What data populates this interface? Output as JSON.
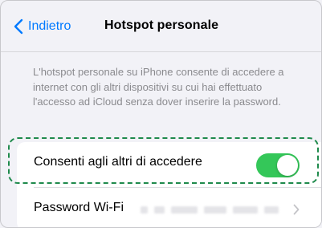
{
  "navbar": {
    "back_label": "Indietro",
    "title": "Hotspot personale"
  },
  "description": "L'hotspot personale su iPhone consente di accedere a internet con gli altri dispositivi su cui hai effettuato l'accesso ad iCloud senza dover inserire la password.",
  "settings": {
    "allow_others_label": "Consenti agli altri di accedere",
    "allow_others_enabled": true,
    "wifi_password_label": "Password Wi-Fi"
  },
  "colors": {
    "accent": "#007aff",
    "toggle_on": "#34c759",
    "highlight": "#1f8a4c",
    "background": "#f2f2f7"
  },
  "icons": {
    "back": "chevron-left-icon",
    "disclosure": "chevron-right-icon"
  }
}
